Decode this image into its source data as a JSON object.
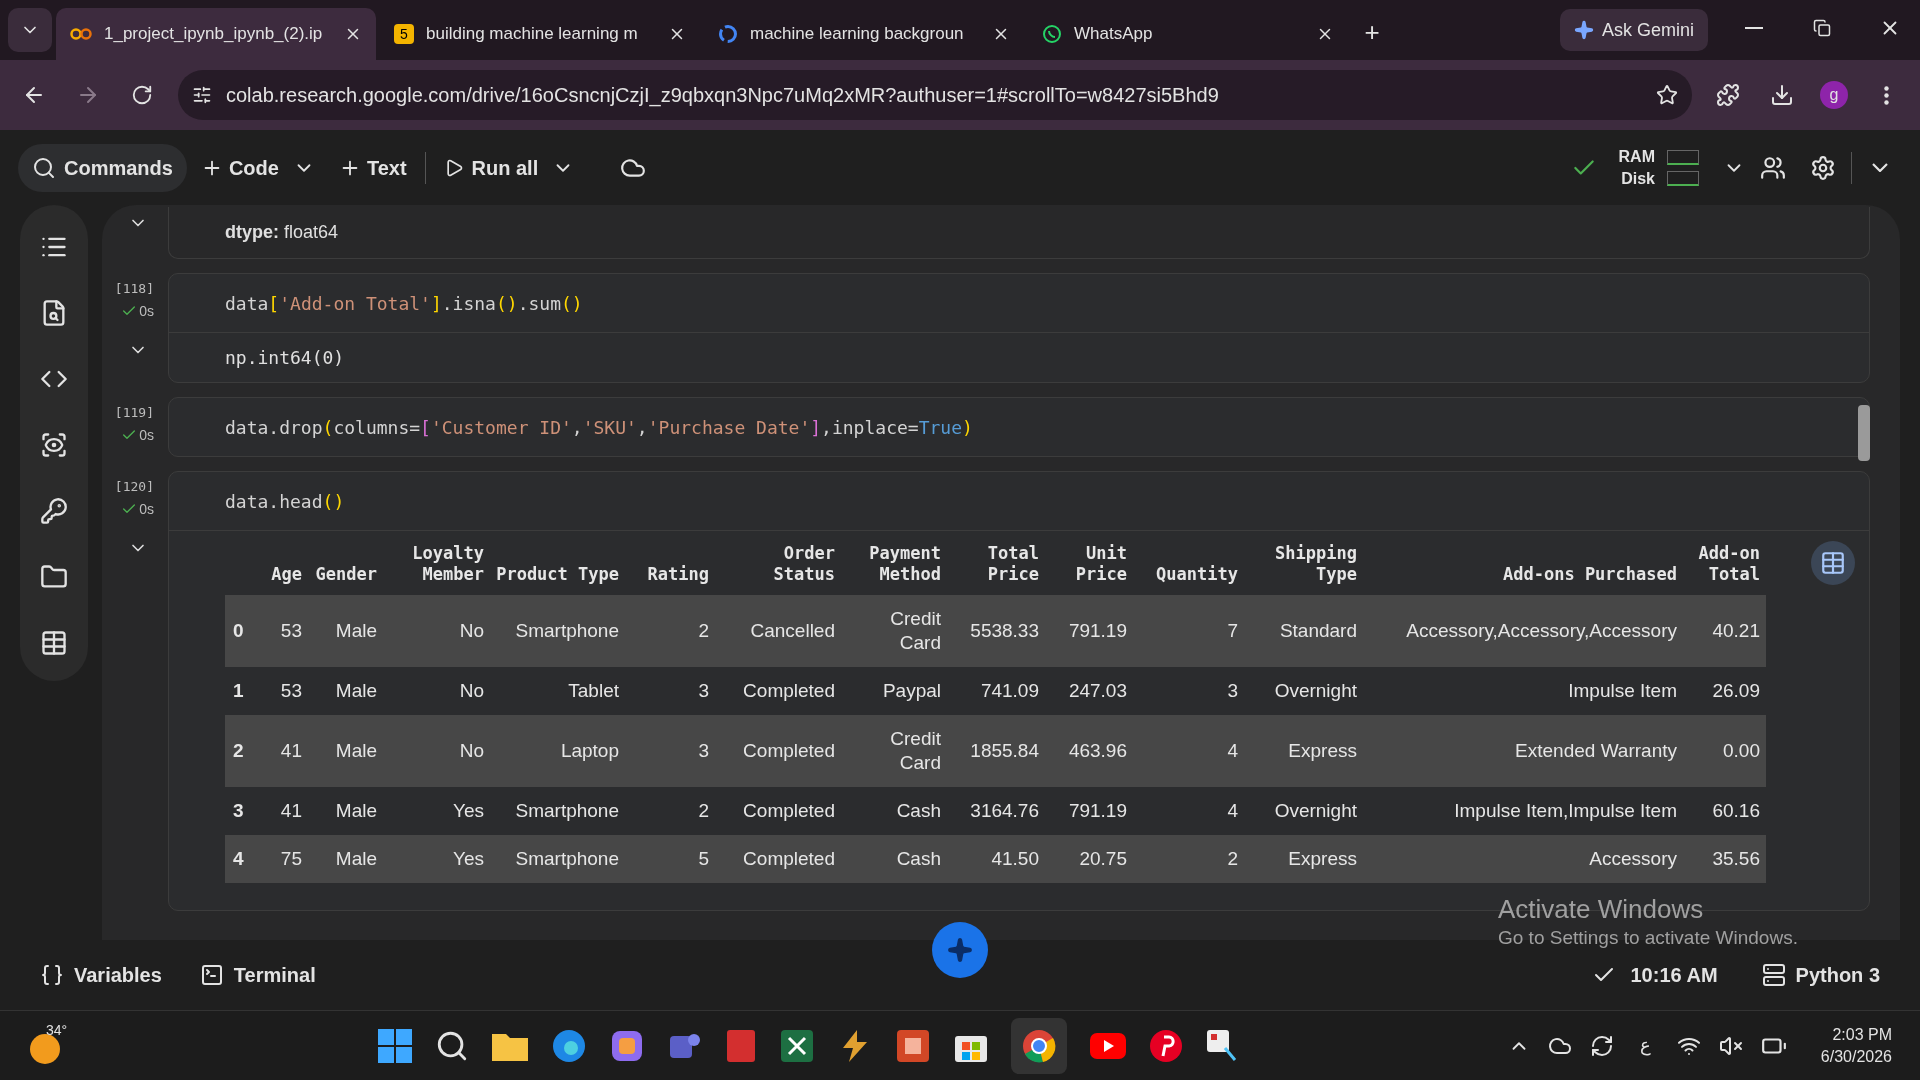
{
  "browser": {
    "tabs": [
      {
        "title": "1_project_ipynb_ipynb_(2).ip",
        "selected": true,
        "kind": "colab"
      },
      {
        "title": "building machine learning m",
        "selected": false,
        "kind": "number"
      },
      {
        "title": "machine learning backgroun",
        "selected": false,
        "kind": "google"
      },
      {
        "title": "WhatsApp",
        "selected": false,
        "kind": "whatsapp"
      }
    ],
    "number_badge": "5",
    "new_tab": "+",
    "ask_gemini": "Ask Gemini",
    "url": "colab.research.google.com/drive/16oCsncnjCzjI_z9qbxqn3Npc7uMq2xMR?authuser=1#scrollTo=w8427si5Bhd9",
    "profile": "g"
  },
  "toolbar": {
    "commands": "Commands",
    "code": "Code",
    "text": "Text",
    "run_all": "Run all",
    "ram": "RAM",
    "disk": "Disk"
  },
  "cells": [
    {
      "kind": "output",
      "output": "**dtype:** float64"
    },
    {
      "kind": "code",
      "exec": "[118]",
      "time": "0s",
      "tokens": [
        {
          "t": "data",
          "kind": "plain"
        },
        {
          "t": "[",
          "kind": "yellow"
        },
        {
          "t": "'Add-on Total'",
          "kind": "string"
        },
        {
          "t": "]",
          "kind": "yellow"
        },
        {
          "t": ".isna",
          "kind": "plain"
        },
        {
          "t": "()",
          "kind": "yellow"
        },
        {
          "t": ".sum",
          "kind": "plain"
        },
        {
          "t": "()",
          "kind": "yellow"
        }
      ],
      "output": "np.int64(0)"
    },
    {
      "kind": "code",
      "exec": "[119]",
      "time": "0s",
      "tokens": [
        {
          "t": "data.drop",
          "kind": "plain"
        },
        {
          "t": "(",
          "kind": "yellow"
        },
        {
          "t": "columns=",
          "kind": "plain"
        },
        {
          "t": "[",
          "kind": "purple"
        },
        {
          "t": "'Customer ID'",
          "kind": "string"
        },
        {
          "t": ",",
          "kind": "plain"
        },
        {
          "t": "'SKU'",
          "kind": "string"
        },
        {
          "t": ",",
          "kind": "plain"
        },
        {
          "t": "'Purchase Date'",
          "kind": "string"
        },
        {
          "t": "]",
          "kind": "purple"
        },
        {
          "t": ",inplace=",
          "kind": "plain"
        },
        {
          "t": "True",
          "kind": "keyword"
        },
        {
          "t": ")",
          "kind": "yellow"
        }
      ]
    },
    {
      "kind": "table",
      "exec": "[120]",
      "time": "0s",
      "tokens": [
        {
          "t": "data.head",
          "kind": "plain"
        },
        {
          "t": "()",
          "kind": "yellow"
        }
      ],
      "table": {
        "columns": [
          "Age",
          "Gender",
          "Loyalty Member",
          "Product Type",
          "Rating",
          "Order Status",
          "Payment Method",
          "Total Price",
          "Unit Price",
          "Quantity",
          "Shipping Type",
          "Add-ons Purchased",
          "Add-on Total"
        ],
        "rows": [
          {
            "index": "0",
            "cells": [
              "53",
              "Male",
              "No",
              "Smartphone",
              "2",
              "Cancelled",
              "Credit Card",
              "5538.33",
              "791.19",
              "7",
              "Standard",
              "Accessory,Accessory,Accessory",
              "40.21"
            ]
          },
          {
            "index": "1",
            "cells": [
              "53",
              "Male",
              "No",
              "Tablet",
              "3",
              "Completed",
              "Paypal",
              "741.09",
              "247.03",
              "3",
              "Overnight",
              "Impulse Item",
              "26.09"
            ]
          },
          {
            "index": "2",
            "cells": [
              "41",
              "Male",
              "No",
              "Laptop",
              "3",
              "Completed",
              "Credit Card",
              "1855.84",
              "463.96",
              "4",
              "Express",
              "Extended Warranty",
              "0.00"
            ]
          },
          {
            "index": "3",
            "cells": [
              "41",
              "Male",
              "Yes",
              "Smartphone",
              "2",
              "Completed",
              "Cash",
              "3164.76",
              "791.19",
              "4",
              "Overnight",
              "Impulse Item,Impulse Item",
              "60.16"
            ]
          },
          {
            "index": "4",
            "cells": [
              "75",
              "Male",
              "Yes",
              "Smartphone",
              "5",
              "Completed",
              "Cash",
              "41.50",
              "20.75",
              "2",
              "Express",
              "Accessory",
              "35.56"
            ]
          }
        ]
      }
    }
  ],
  "activation": {
    "title": "Activate Windows",
    "subtitle": "Go to Settings to activate Windows."
  },
  "status_bar": {
    "variables": "Variables",
    "terminal": "Terminal",
    "time": "10:16 AM",
    "runtime": "Python 3"
  },
  "taskbar": {
    "temperature": "34°",
    "language": "ع",
    "time": "2:03 PM",
    "date": "6/30/2026"
  }
}
